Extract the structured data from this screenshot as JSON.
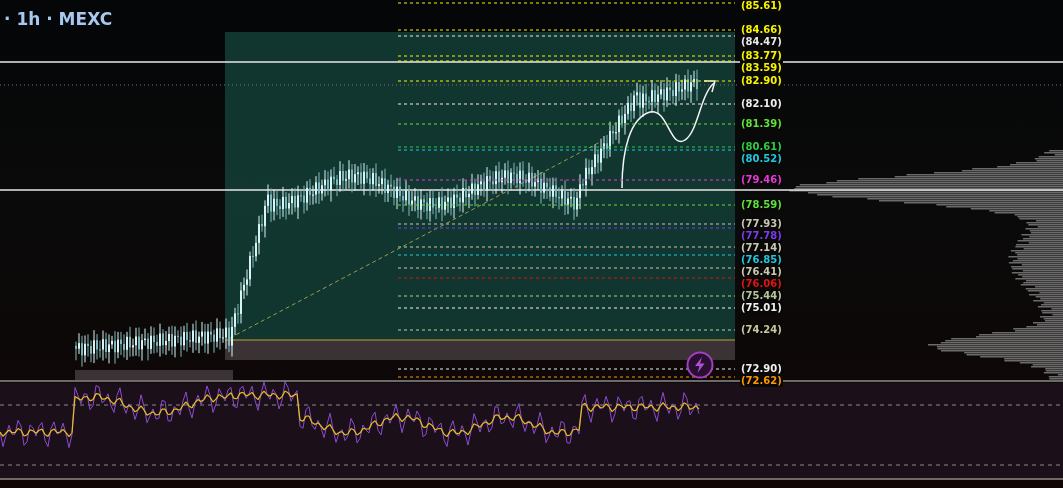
{
  "header": {
    "text": "· 1h · MEXC"
  },
  "price_levels": [
    {
      "label": "(85.61)",
      "color": "#f5f500"
    },
    {
      "label": "(84.66)",
      "color": "#f5f500"
    },
    {
      "label": "(84.47)",
      "color": "#e8e8e8"
    },
    {
      "label": "(83.77)",
      "color": "#f5f500"
    },
    {
      "label": "(83.59)",
      "color": "#f5f500"
    },
    {
      "label": "(82.90)",
      "color": "#f5f500"
    },
    {
      "label": "(82.10)",
      "color": "#eeeeee"
    },
    {
      "label": "(81.39)",
      "color": "#5ee03a"
    },
    {
      "label": "(80.61)",
      "color": "#2ecc40"
    },
    {
      "label": "(80.52)",
      "color": "#1ec8e0"
    },
    {
      "label": "(79.46)",
      "color": "#e23ad8"
    },
    {
      "label": "(78.59)",
      "color": "#5ee03a"
    },
    {
      "label": "(77.93)",
      "color": "#c8c8b4"
    },
    {
      "label": "(77.78)",
      "color": "#7a3cf0"
    },
    {
      "label": "(77.14)",
      "color": "#c8c8b4"
    },
    {
      "label": "(76.85)",
      "color": "#1ec8e0"
    },
    {
      "label": "(76.41)",
      "color": "#c8c8b4"
    },
    {
      "label": "(76.06)",
      "color": "#e01414"
    },
    {
      "label": "(75.44)",
      "color": "#b4c8a0"
    },
    {
      "label": "(75.01)",
      "color": "#f0f0f0"
    },
    {
      "label": "(74.24)",
      "color": "#c8c8a0"
    },
    {
      "label": "(72.90)",
      "color": "#f0f0f0"
    },
    {
      "label": "(72.62)",
      "color": "#ff9800"
    }
  ]
}
